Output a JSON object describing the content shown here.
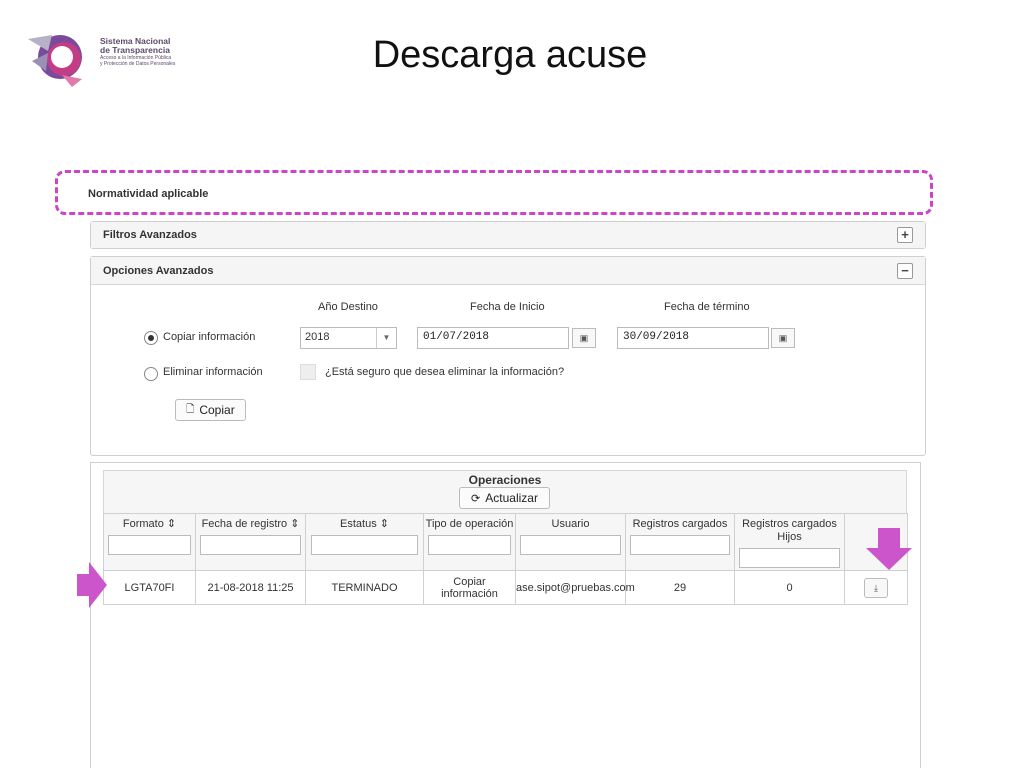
{
  "slide": {
    "title": "Descarga acuse"
  },
  "logo": {
    "line1": "Sistema Nacional",
    "line2": "de Transparencia",
    "line3": "Acceso a la Información Pública",
    "line4": "y Protección de Datos Personales"
  },
  "normatividad": {
    "label": "Normatividad aplicable"
  },
  "filtros": {
    "title": "Filtros Avanzados",
    "toggle": "+"
  },
  "opciones": {
    "title": "Opciones Avanzados",
    "toggle": "−",
    "col_anio": "Año Destino",
    "col_inicio": "Fecha de Inicio",
    "col_termino": "Fecha de término",
    "radio_copiar": "Copiar información",
    "radio_eliminar": "Eliminar información",
    "anio_value": "2018",
    "inicio_value": "01/07/2018",
    "termino_value": "30/09/2018",
    "confirm_label": "¿Está seguro que desea eliminar la información?",
    "copiar_button": "Copiar"
  },
  "operaciones": {
    "title": "Operaciones",
    "refresh_button": "Actualizar",
    "columns": [
      "Formato ⇕",
      "Fecha de registro ⇕",
      "Estatus ⇕",
      "Tipo de operación",
      "Usuario",
      "Registros cargados",
      "Registros cargados Hijos",
      ""
    ],
    "rows": [
      {
        "formato": "LGTA70FI",
        "fecha": "21-08-2018 11:25",
        "estatus": "TERMINADO",
        "tipo": "Copiar información",
        "usuario": "ase.sipot@pruebas.com",
        "registros": "29",
        "hijos": "0"
      }
    ]
  },
  "colors": {
    "highlight": "#cc44cc",
    "arrow": "#cc55cc"
  },
  "icons": {
    "refresh": "refresh-icon",
    "calendar": "calendar-icon",
    "download": "download-icon",
    "copy": "copy-icon"
  }
}
